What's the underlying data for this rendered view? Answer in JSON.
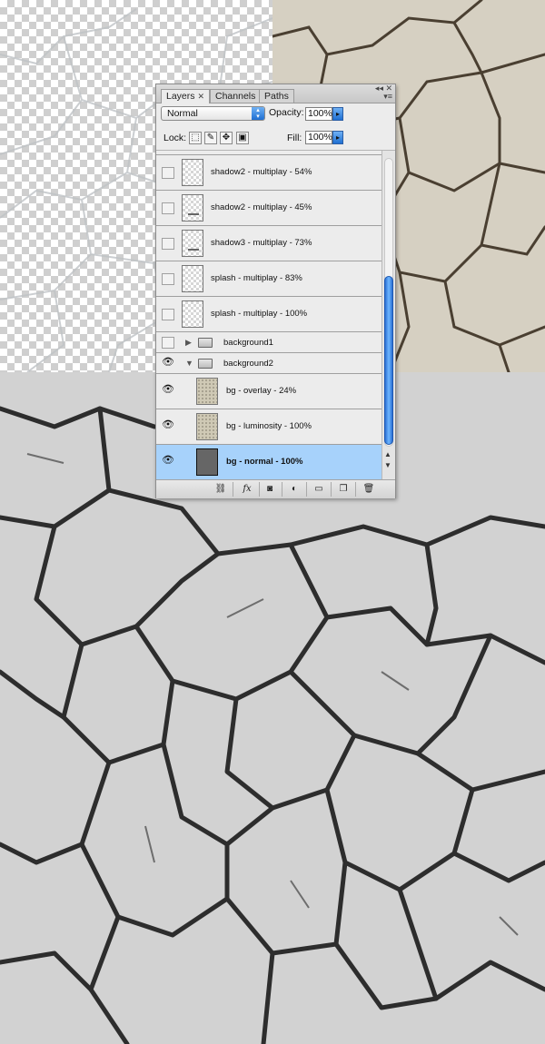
{
  "tabs": [
    {
      "label": "Layers",
      "active": true
    },
    {
      "label": "Channels",
      "active": false
    },
    {
      "label": "Paths",
      "active": false
    }
  ],
  "blend_mode": "Normal",
  "opacity": {
    "label": "Opacity:",
    "value": "100%"
  },
  "lock": {
    "label": "Lock:"
  },
  "fill": {
    "label": "Fill:",
    "value": "100%"
  },
  "layers": [
    {
      "name": "shadow2 - multiplay - 54%",
      "visible": false
    },
    {
      "name": "shadow2 - multiplay - 45%",
      "visible": false
    },
    {
      "name": "shadow3 - multiplay - 73%",
      "visible": false
    },
    {
      "name": "splash - multiplay - 83%",
      "visible": false
    },
    {
      "name": "splash - multiplay - 100%",
      "visible": false
    }
  ],
  "groups": [
    {
      "name": "background1",
      "expanded": false,
      "visible": false
    },
    {
      "name": "background2",
      "expanded": true,
      "visible": true,
      "children": [
        {
          "name": "bg - overlay - 24%",
          "visible": true
        },
        {
          "name": "bg - luminosity - 100%",
          "visible": true
        },
        {
          "name": "bg - normal - 100%",
          "visible": true,
          "selected": true
        }
      ]
    }
  ],
  "colors": {
    "selection": "#a7d2fb",
    "accent": "#2a6fd4",
    "sepia": "#d6d0c2",
    "gray": "#cfcfcf"
  },
  "icons": [
    "link-layers-icon",
    "fx-icon",
    "mask-icon",
    "adjustment-icon",
    "new-group-icon",
    "new-layer-icon",
    "trash-icon",
    "eye-icon",
    "folder-icon",
    "lock-icon",
    "move-icon",
    "brush-icon",
    "panel-menu-icon"
  ]
}
